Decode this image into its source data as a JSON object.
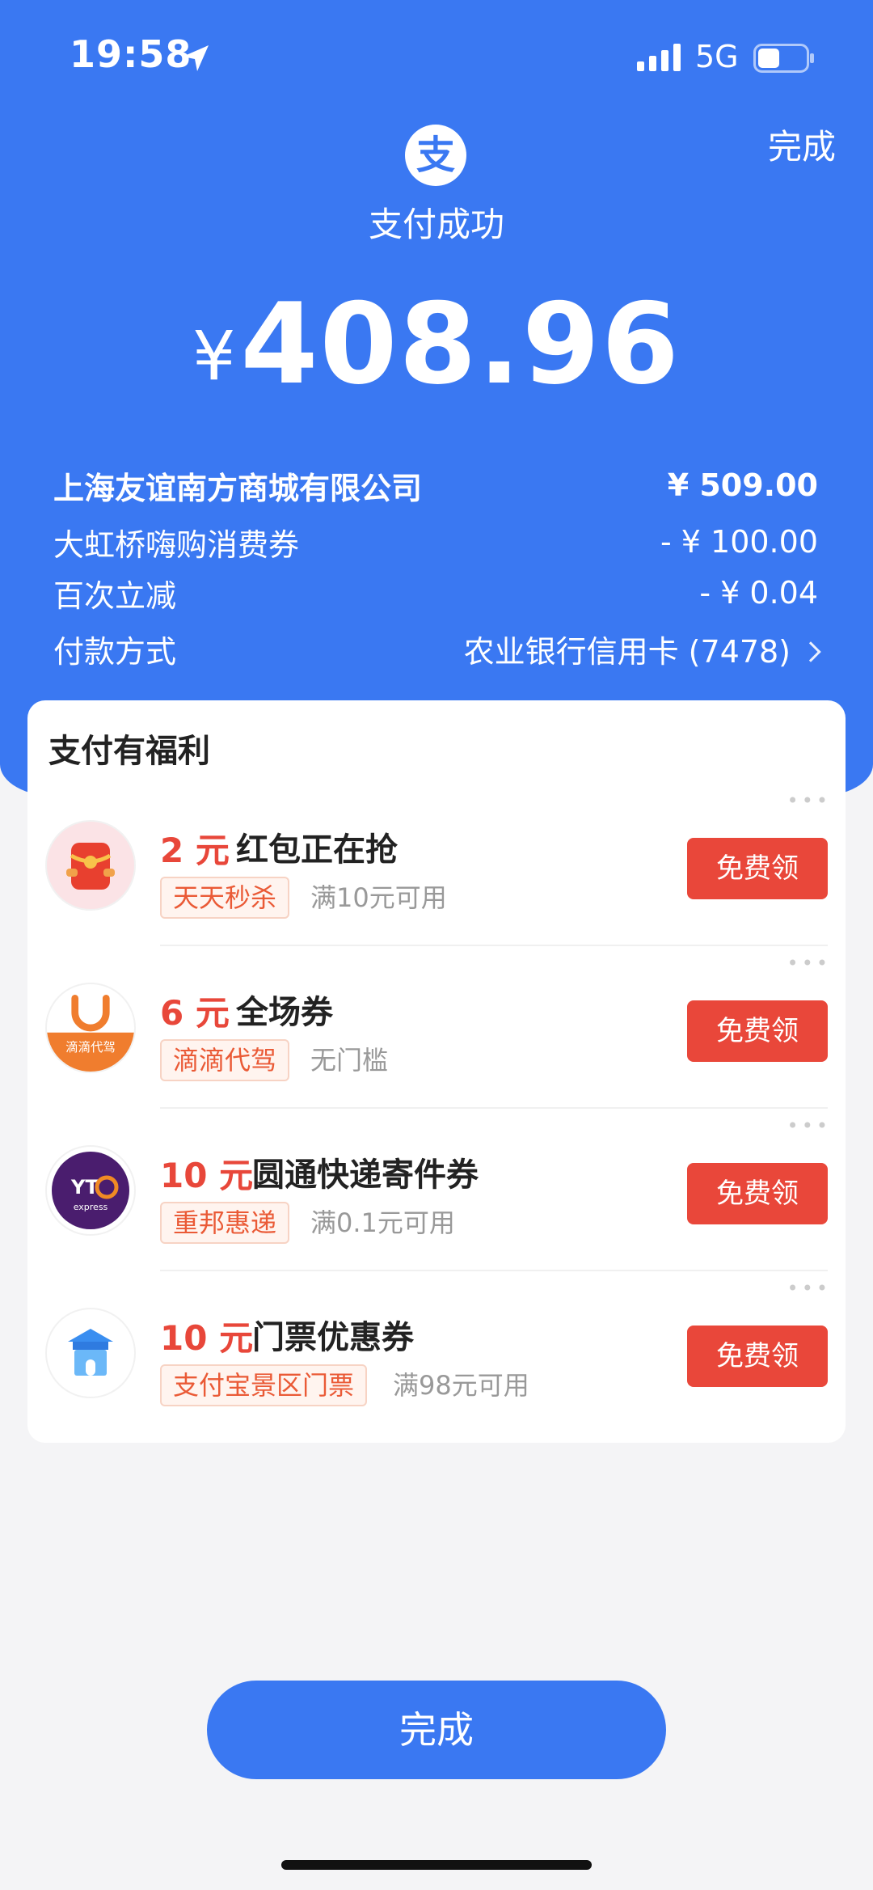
{
  "status_bar": {
    "time": "19:58",
    "network": "5G"
  },
  "header": {
    "done_label": "完成",
    "logo_char": "支",
    "title": "支付成功",
    "currency": "¥",
    "amount": "408.96"
  },
  "details": {
    "merchant": {
      "label": "上海友谊南方商城有限公司",
      "value": "¥ 509.00"
    },
    "coupon": {
      "label": "大虹桥嗨购消费券",
      "value": "- ¥ 100.00"
    },
    "discount": {
      "label": "百次立减",
      "value": "- ¥ 0.04"
    },
    "payment_method": {
      "label": "付款方式",
      "value": "农业银行信用卡 (7478)"
    }
  },
  "benefits": {
    "title": "支付有福利",
    "items": [
      {
        "amount": "2 元",
        "name": "红包正在抢",
        "tag": "天天秒杀",
        "condition": "满10元可用",
        "button": "免费领",
        "icon": "red-envelope-icon"
      },
      {
        "amount": "6 元",
        "name": "全场券",
        "tag": "滴滴代驾",
        "condition": "无门槛",
        "button": "免费领",
        "icon": "didi-driver-icon",
        "icon_text": "滴滴代驾"
      },
      {
        "amount": "10 元",
        "name": "圆通快递寄件券",
        "tag": "重邦惠递",
        "condition": "满0.1元可用",
        "button": "免费领",
        "icon": "yto-express-icon",
        "icon_text": "express"
      },
      {
        "amount": "10 元",
        "name": "门票优惠券",
        "tag": "支付宝景区门票",
        "condition": "满98元可用",
        "button": "免费领",
        "icon": "scenic-ticket-icon"
      }
    ]
  },
  "footer": {
    "done_label": "完成"
  },
  "colors": {
    "primary": "#3a78f2",
    "accent_red": "#e9473a",
    "tag_orange": "#ea5a36"
  }
}
